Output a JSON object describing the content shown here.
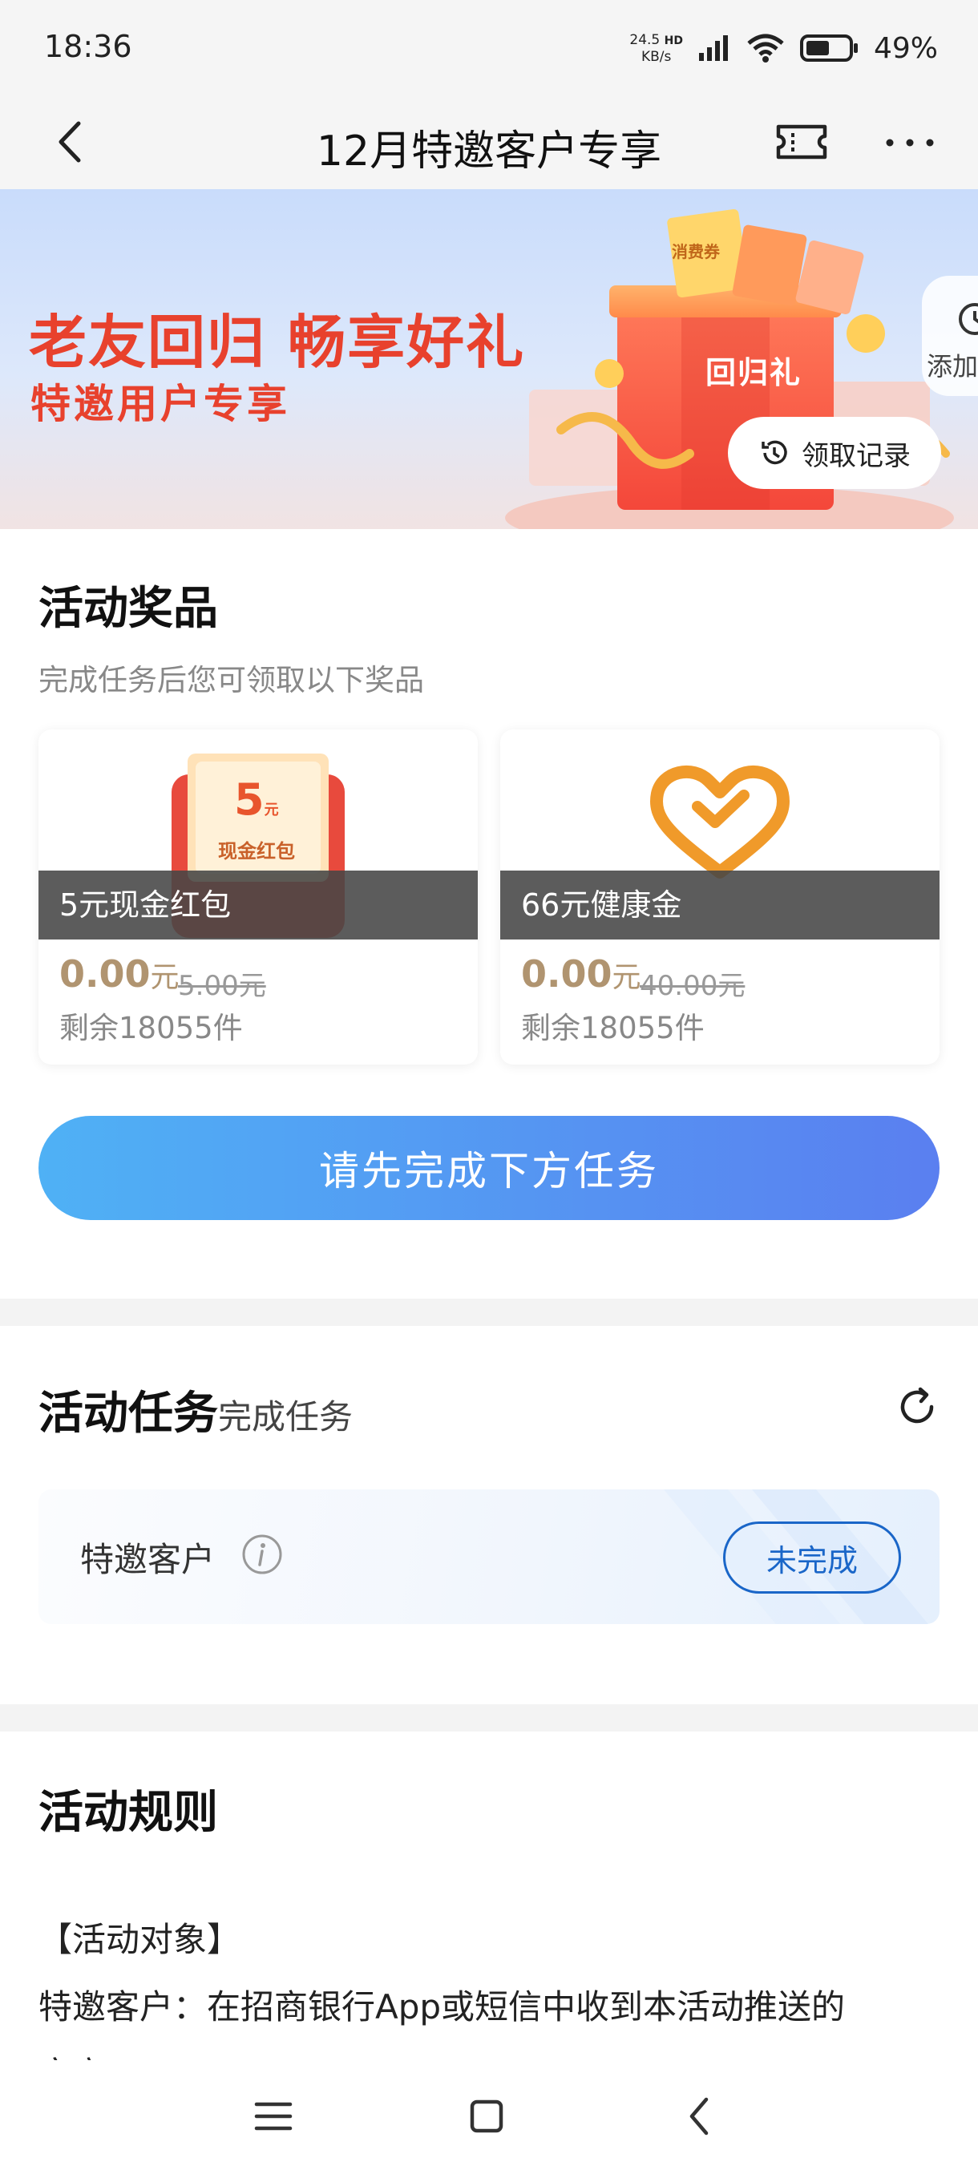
{
  "status_bar": {
    "time": "18:36",
    "net_speed_value": "24.5",
    "net_speed_unit": "KB/s",
    "net_hd": "HD",
    "battery": "49%"
  },
  "nav": {
    "title": "12月特邀客户专享",
    "back_icon": "chevron-left-icon",
    "ticket_icon": "ticket-icon",
    "more_icon": "more-dots-icon"
  },
  "banner": {
    "headline": "老友回归 畅享好礼",
    "subline": "特邀用户专享",
    "gift_box_text": "回归礼",
    "coupon_text": "消费券",
    "record_button": "领取记录",
    "add_label": "添加"
  },
  "prizes": {
    "title": "活动奖品",
    "subtitle": "完成任务后您可领取以下奖品",
    "items": [
      {
        "name": "5元现金红包",
        "price": "0.00",
        "price_unit": "元",
        "original_price": "5.00元",
        "remaining": "剩余18055件",
        "badge_amount": "5",
        "badge_unit": "元",
        "badge_text": "现金红包"
      },
      {
        "name": "66元健康金",
        "price": "0.00",
        "price_unit": "元",
        "original_price": "40.00元",
        "remaining": "剩余18055件"
      }
    ],
    "cta": "请先完成下方任务"
  },
  "tasks": {
    "title": "活动任务",
    "subtitle": "完成任务",
    "items": [
      {
        "label": "特邀客户",
        "status": "未完成"
      }
    ]
  },
  "rules": {
    "title": "活动规则",
    "lines": [
      "【活动对象】",
      "特邀客户：在招商银行App或短信中收到本活动推送的",
      "客户"
    ]
  },
  "colors": {
    "accent_blue": "#1a66c8",
    "banner_red": "#e8412d",
    "price_gold": "#b09470",
    "cta_start": "#4fb1f5",
    "cta_end": "#5a7ff0"
  }
}
